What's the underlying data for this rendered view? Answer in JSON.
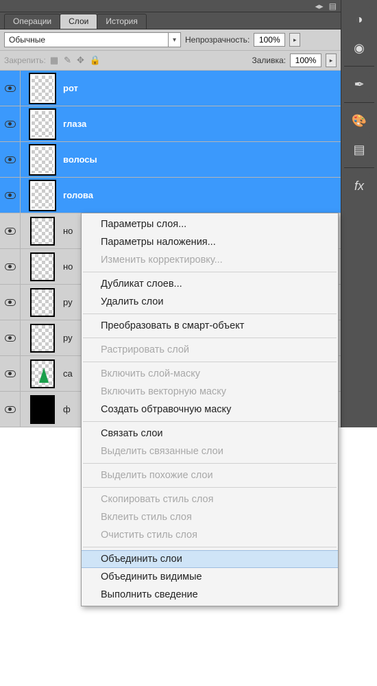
{
  "tabs": {
    "ops": "Операции",
    "layers": "Слои",
    "history": "История"
  },
  "blend_mode": "Обычные",
  "opacity_label": "Непрозрачность:",
  "opacity_value": "100%",
  "fill_label": "Заливка:",
  "fill_value": "100%",
  "lock_label": "Закрепить:",
  "layers": [
    {
      "name": "рот",
      "selected": true,
      "thumb": "checker"
    },
    {
      "name": "глаза",
      "selected": true,
      "thumb": "checker"
    },
    {
      "name": "волосы",
      "selected": true,
      "thumb": "checker"
    },
    {
      "name": "голова",
      "selected": true,
      "thumb": "checker"
    },
    {
      "name": "но",
      "selected": false,
      "thumb": "checker"
    },
    {
      "name": "но",
      "selected": false,
      "thumb": "checker"
    },
    {
      "name": "ру",
      "selected": false,
      "thumb": "checker"
    },
    {
      "name": "ру",
      "selected": false,
      "thumb": "checker"
    },
    {
      "name": "са",
      "selected": false,
      "thumb": "tree"
    },
    {
      "name": "ф",
      "selected": false,
      "thumb": "black"
    }
  ],
  "context_menu": [
    {
      "label": "Параметры слоя...",
      "enabled": true
    },
    {
      "label": "Параметры наложения...",
      "enabled": true
    },
    {
      "label": "Изменить корректировку...",
      "enabled": false
    },
    {
      "sep": true
    },
    {
      "label": "Дубликат слоев...",
      "enabled": true
    },
    {
      "label": "Удалить слои",
      "enabled": true
    },
    {
      "sep": true
    },
    {
      "label": "Преобразовать в смарт-объект",
      "enabled": true
    },
    {
      "sep": true
    },
    {
      "label": "Растрировать слой",
      "enabled": false
    },
    {
      "sep": true
    },
    {
      "label": "Включить слой-маску",
      "enabled": false
    },
    {
      "label": "Включить векторную маску",
      "enabled": false
    },
    {
      "label": "Создать обтравочную маску",
      "enabled": true
    },
    {
      "sep": true
    },
    {
      "label": "Связать слои",
      "enabled": true
    },
    {
      "label": "Выделить связанные слои",
      "enabled": false
    },
    {
      "sep": true
    },
    {
      "label": "Выделить похожие слои",
      "enabled": false
    },
    {
      "sep": true
    },
    {
      "label": "Скопировать стиль слоя",
      "enabled": false
    },
    {
      "label": "Вклеить стиль слоя",
      "enabled": false
    },
    {
      "label": "Очистить стиль слоя",
      "enabled": false
    },
    {
      "sep": true
    },
    {
      "label": "Объединить слои",
      "enabled": true,
      "hover": true
    },
    {
      "label": "Объединить видимые",
      "enabled": true
    },
    {
      "label": "Выполнить сведение",
      "enabled": true
    }
  ]
}
